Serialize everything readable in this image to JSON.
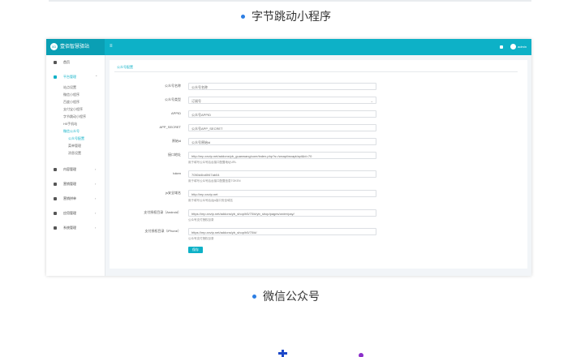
{
  "captions": {
    "top": "字节跳动小程序",
    "bottom": "微信公众号"
  },
  "app": {
    "brand": "壹佰智慧驿站",
    "logo_text": "XD",
    "user": "admin"
  },
  "sidebar": {
    "items": [
      {
        "label": "首页"
      },
      {
        "label": "平台管理",
        "expanded": true
      },
      {
        "label": "内容管理"
      },
      {
        "label": "营销管理"
      },
      {
        "label": "营销拼单"
      },
      {
        "label": "应用管理"
      },
      {
        "label": "系统管理"
      }
    ],
    "platform_subs": [
      "站点设置",
      "微信小程序",
      "百度小程序",
      "支付宝小程序",
      "字节跳动小程序",
      "H5手机站",
      "微信公众号"
    ],
    "wechat_subs": [
      "公众号配置",
      "菜单管理",
      "消息设置"
    ]
  },
  "main": {
    "tab": "公众号配置",
    "fields": [
      {
        "label": "公众号名称",
        "value": "公众号名称"
      },
      {
        "label": "公众号类型",
        "value": "订阅号"
      },
      {
        "label": "APPID",
        "value": "公众号APPID"
      },
      {
        "label": "APP_SECRET",
        "value": "公众号APP_SECRET"
      },
      {
        "label": "原始id",
        "value": "公众号原始id"
      },
      {
        "label": "接口地址",
        "value": "http://mp.xxvip.net/addons/yb_guanwang/core/index.php?s=/wxapi/wxapi/api&id=70",
        "hint": "用于填写公众号后台接口配置地址URL"
      },
      {
        "label": "token",
        "value": "7050d4bd0f47ab04",
        "hint": "用于填写公众号后台接口配置信息TOKEN"
      },
      {
        "label": "js安全域名",
        "value": "http://mp.xxvip.net",
        "hint": "用于填写公众号后台js接口安全域名"
      },
      {
        "label": "支付授权目录（Android）",
        "value": "https://mp.xxvip.net/addons/yb_shop/h5/70/#/yb_shop/pages/order/pay/",
        "hint": "公众号支付授权目录"
      },
      {
        "label": "支付授权目录（iPhone）",
        "value": "https://mp.xxvip.net/addons/yb_shop/h5/70/#/",
        "hint": "公众号支付授权目录"
      }
    ],
    "save_label": "保存"
  },
  "colors": {
    "accent": "#0db1c7",
    "bullet": "#2d7ee3"
  }
}
